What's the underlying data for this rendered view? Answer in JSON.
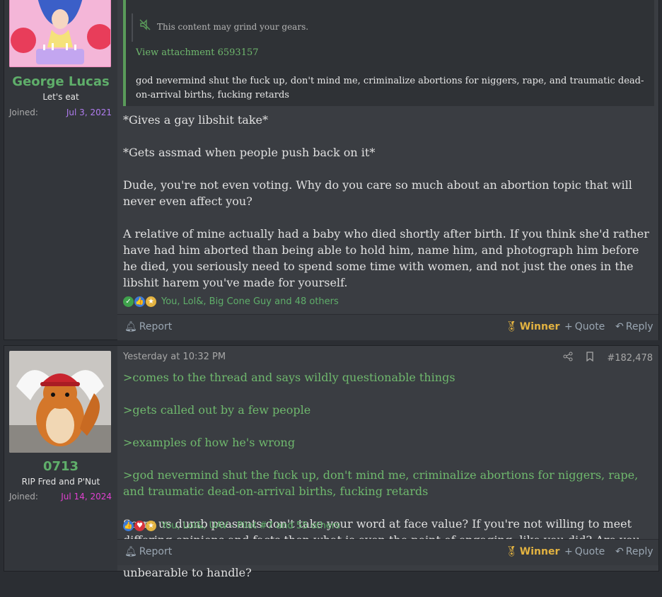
{
  "post1": {
    "user": {
      "name": "George Lucas",
      "title": "Let's eat",
      "joined_label": "Joined:",
      "joined_date": "Jul 3, 2021",
      "joined_color": "#b07cf0"
    },
    "quote": {
      "spoiler_text": "This content may grind your gears.",
      "attachment_link": "View attachment 6593157",
      "quoted_text": "god nevermind shut the fuck up, don't mind me, criminalize abortions for niggers, rape, and traumatic dead-on-arrival births, fucking retards"
    },
    "paragraphs": [
      "*Gives a gay libshit take*",
      "*Gets assmad when people push back on it*",
      "Dude, you're not even voting. Why do you care so much about an abortion topic that will never even affect you?",
      "A relative of mine actually had a baby who died shortly after birth. If you think she'd rather have had him aborted than being able to hold him, name him, and photograph him before he died, you seriously need to spend some time with women, and not just the ones in the libshit harem you've made for yourself."
    ],
    "reactions_text": "You, Lol&, Big Cone Guy and 48 others",
    "footer": {
      "report": "Report",
      "winner": "Winner",
      "quote": "Quote",
      "reply": "Reply"
    }
  },
  "post2": {
    "user": {
      "name": "0713",
      "title": "RIP Fred and P'Nut",
      "joined_label": "Joined:",
      "joined_date": "Jul 14, 2024",
      "joined_color": "#e040d0"
    },
    "timestamp": "Yesterday at 10:32 PM",
    "post_number": "#182,478",
    "greentext": [
      ">comes to the thread and says wildly questionable things",
      ">gets called out by a few people",
      ">examples of how he's wrong",
      ">god nevermind shut the fuck up, don't mind me, criminalize abortions for niggers, rape, and traumatic dead-on-arrival births, fucking retards"
    ],
    "paragraph": "Sorry us dumb peasants don't take your word at face value? If you're not willing to meet differing opinions and facts then what is even the point of engaging, like you did? Are you so used to people sucking your cock unquestionably that the tiniest bit of push back is unbearable to handle?",
    "reactions_text": "You, Lol&, UAV - Pilot #7 and 55 others",
    "footer": {
      "report": "Report",
      "winner": "Winner",
      "quote": "Quote",
      "reply": "Reply"
    }
  },
  "icons": {
    "spoiler": "mute-icon",
    "report": "bell-icon",
    "winner": "medal-icon",
    "quote": "plus-icon",
    "reply": "reply-arrow-icon",
    "share": "share-icon",
    "bookmark": "bookmark-icon"
  },
  "colors": {
    "accent_green": "#5fae6a",
    "greentext": "#6fb86d",
    "winner": "#e3b341",
    "link": "#9aa6b2"
  }
}
